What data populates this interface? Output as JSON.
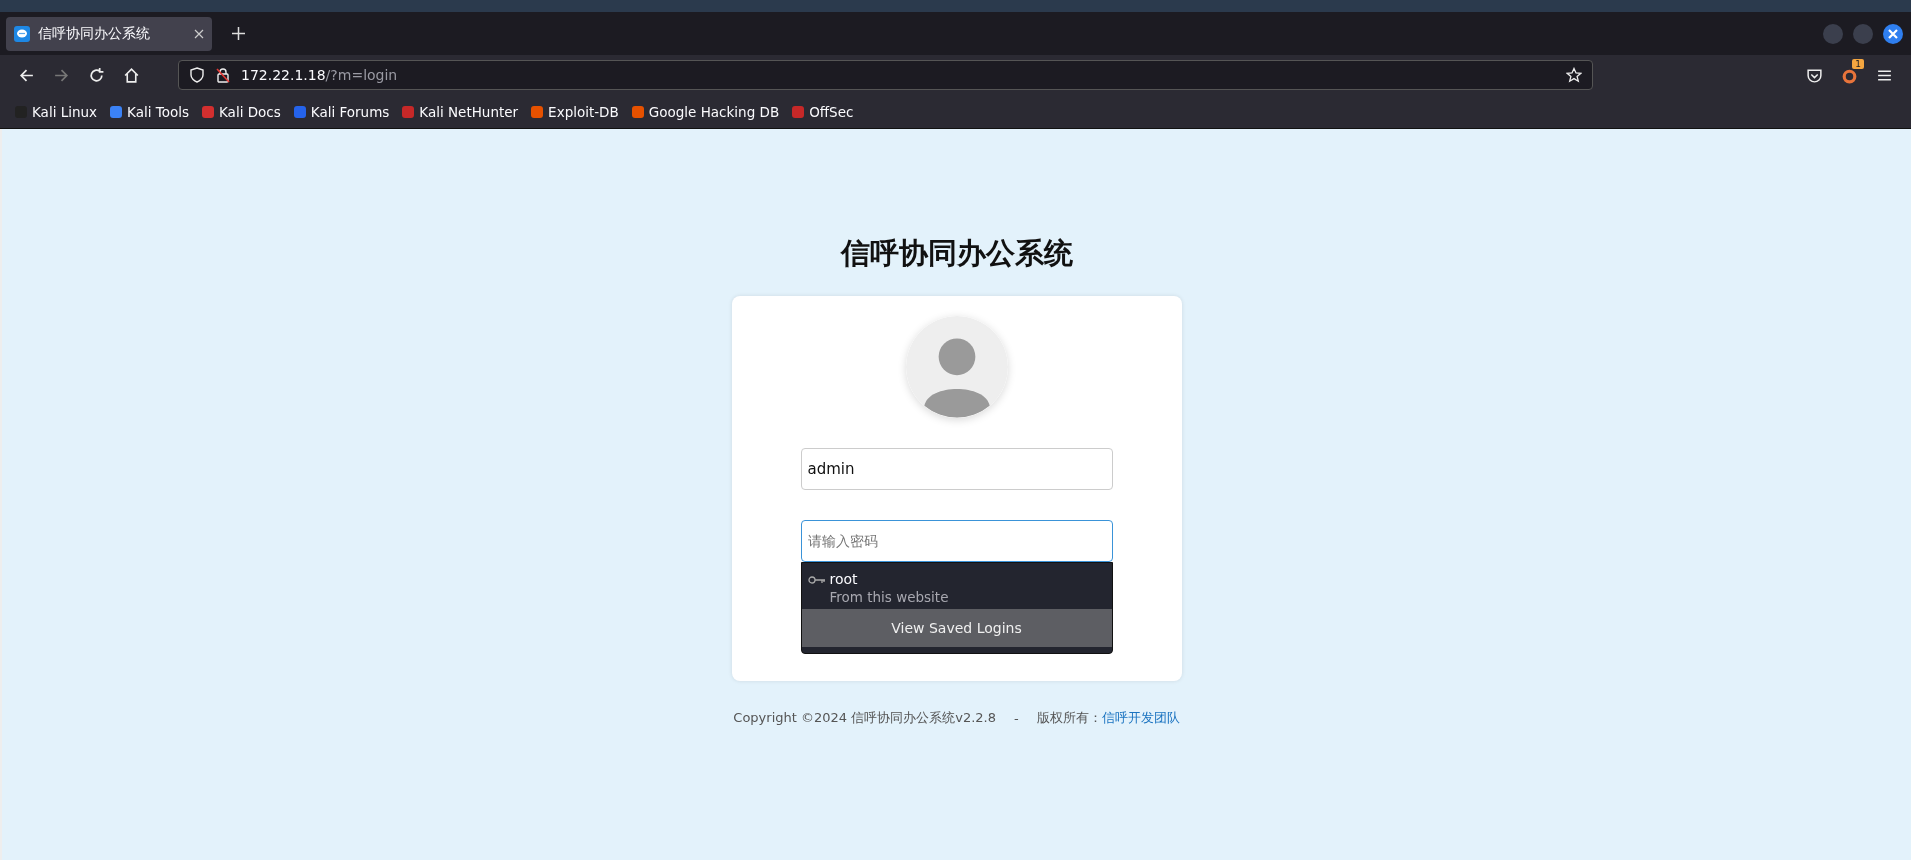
{
  "browser": {
    "tabs": [
      {
        "title": "信呼协同办公系统",
        "selected": true
      }
    ],
    "url": {
      "host": "172.22.1.18",
      "path": "/?m=login"
    },
    "bookmarks": [
      "Kali Linux",
      "Kali Tools",
      "Kali Docs",
      "Kali Forums",
      "Kali NetHunter",
      "Exploit-DB",
      "Google Hacking DB",
      "OffSec"
    ],
    "extension_badge": "1"
  },
  "page": {
    "title": "信呼协同办公系统",
    "username": {
      "value": "admin"
    },
    "password": {
      "placeholder": "请输入密码",
      "focused": true
    },
    "autocomplete": {
      "entries": [
        {
          "login": "root",
          "source": "From this website"
        }
      ],
      "footer_button": "View Saved Logins"
    },
    "footer": {
      "copyright": "Copyright ©2024 信呼协同办公系统v2.2.8",
      "separator": "-",
      "rights_label": "版权所有：",
      "rights_link": "信呼开发团队"
    }
  }
}
